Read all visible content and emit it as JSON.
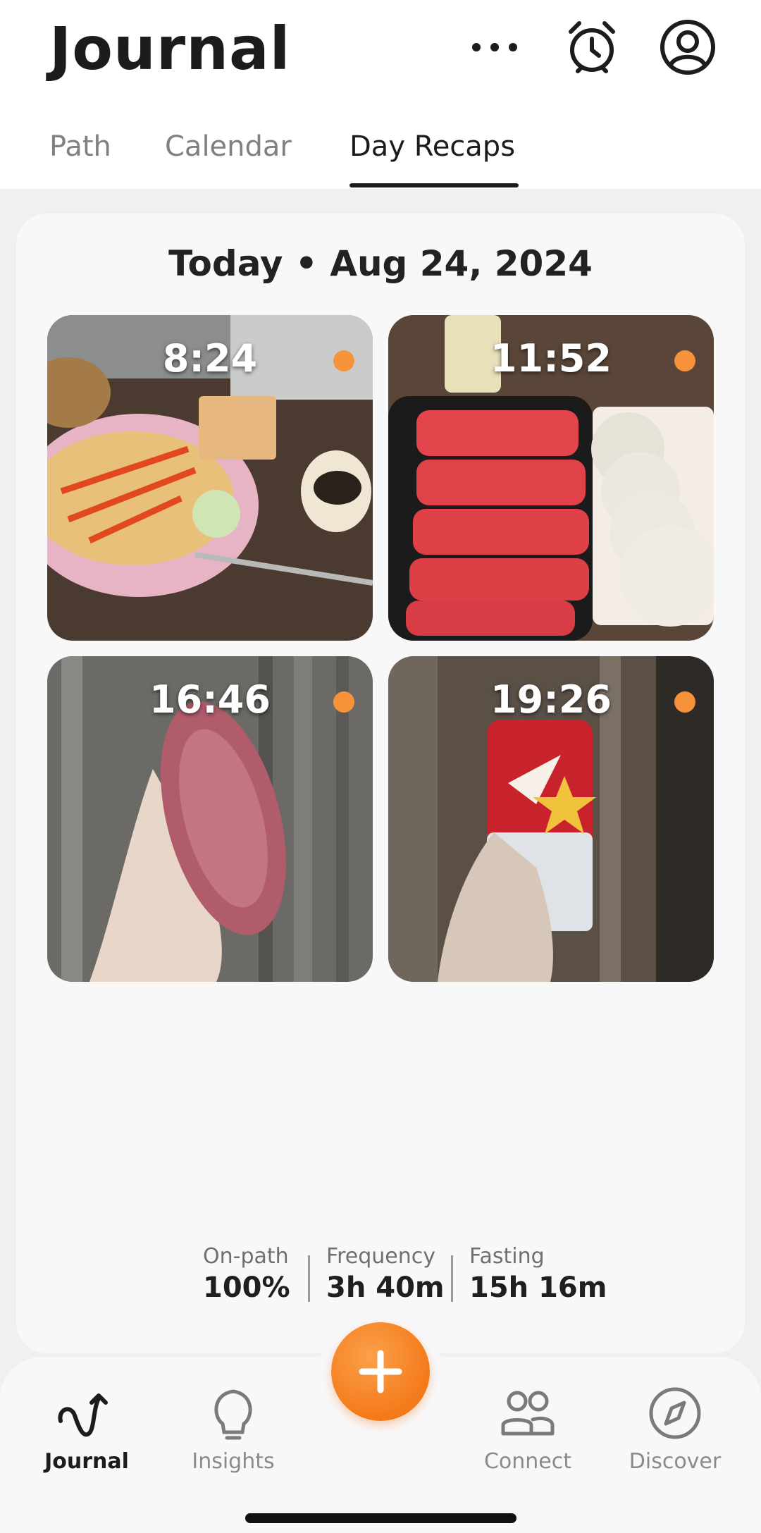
{
  "header": {
    "title": "Journal"
  },
  "tabs": [
    {
      "label": "Path"
    },
    {
      "label": "Calendar"
    },
    {
      "label": "Day Recaps"
    }
  ],
  "recap": {
    "date": "Today • Aug 24, 2024",
    "entries": [
      {
        "time": "8:24"
      },
      {
        "time": "11:52"
      },
      {
        "time": "16:46"
      },
      {
        "time": "19:26"
      }
    ],
    "stats": [
      {
        "label": "On-path",
        "value": "100%"
      },
      {
        "label": "Frequency",
        "value": "3h 40m"
      },
      {
        "label": "Fasting",
        "value": "15h 16m"
      }
    ]
  },
  "nav": [
    {
      "label": "Journal",
      "icon": "journal-icon"
    },
    {
      "label": "Insights",
      "icon": "lightbulb-icon"
    },
    {
      "label": "Connect",
      "icon": "people-icon"
    },
    {
      "label": "Discover",
      "icon": "compass-icon"
    }
  ],
  "colors": {
    "accent": "#f6933a",
    "fab": "#f47a1a",
    "text": "#1c1c1c"
  }
}
